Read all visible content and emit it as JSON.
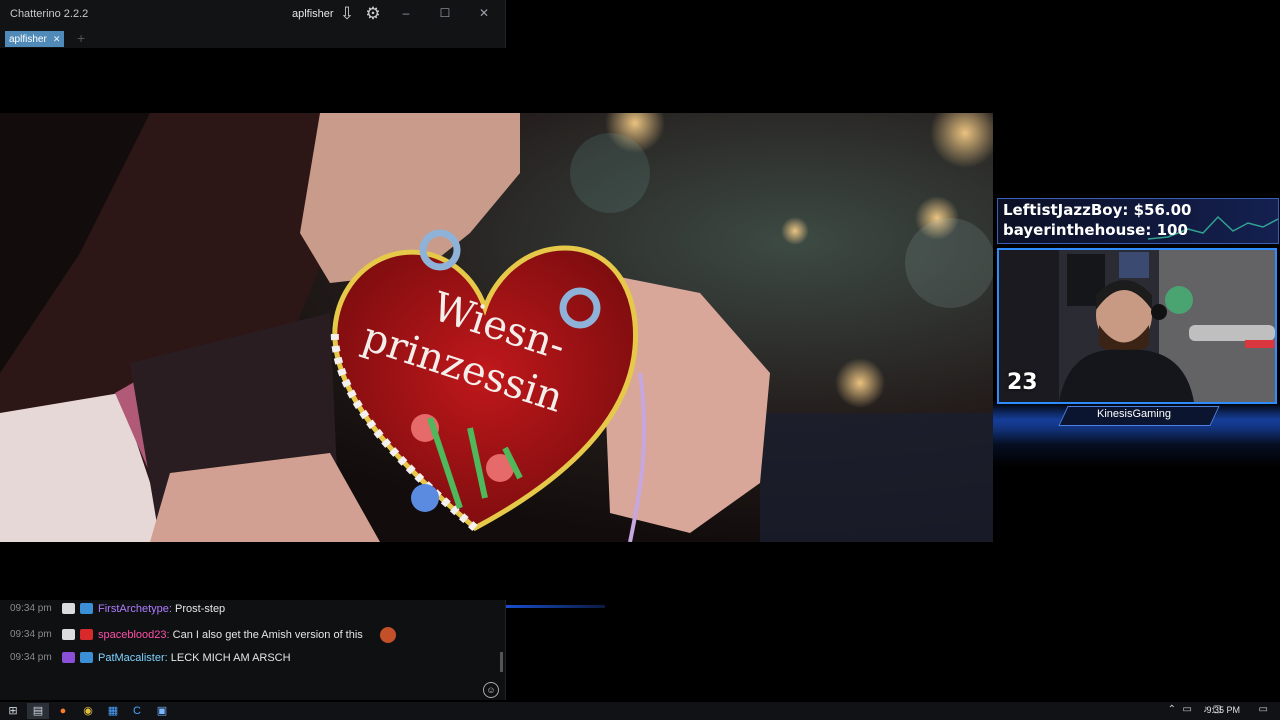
{
  "chatterino": {
    "app_title": "Chatterino 2.2.2",
    "username": "aplfisher",
    "icons": {
      "download": "download-arrow-icon",
      "settings": "gear-icon"
    },
    "window_buttons": {
      "minimize": "–",
      "maximize": "☐",
      "close": "✕"
    },
    "tab": {
      "label": "aplfisher",
      "close": "✕"
    },
    "add_tab": "+"
  },
  "messages": [
    {
      "time": "09:34 pm",
      "user": "FirstArchetype",
      "user_color": "#b07cff",
      "text": "Prost-step"
    },
    {
      "time": "09:34 pm",
      "user": "spaceblood23",
      "user_color": "#ff4fa8",
      "text": "Can I also get the Amish version of this"
    },
    {
      "time": "09:34 pm",
      "user": "PatMacalister",
      "user_color": "#7fd3ff",
      "text": "LECK MICH AM ARSCH"
    }
  ],
  "video": {
    "heart_line1": "Wiesn-",
    "heart_line2": "prinzessin"
  },
  "overlay": {
    "alert1": "LeftistJazzBoy: $56.00",
    "alert2": "bayerinthehouse: 100",
    "cam_number": "23",
    "brand": "KinesisGaming"
  },
  "taskbar": {
    "clock": "9:35 PM"
  },
  "colors": {
    "tab_accent": "#4f8ab8",
    "overlay_border": "#2f8cff",
    "chat_bg": "#0e1012"
  }
}
